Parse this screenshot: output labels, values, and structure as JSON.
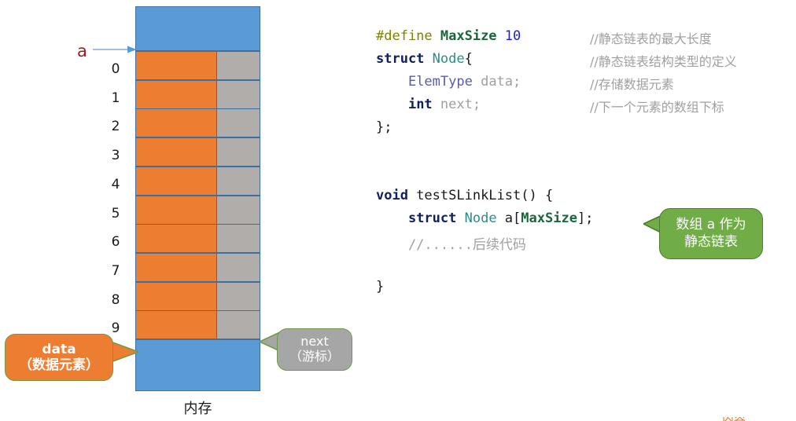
{
  "diagram": {
    "pointer_label": "a",
    "caption": "内存",
    "row_indices": [
      "0",
      "1",
      "2",
      "3",
      "4",
      "5",
      "6",
      "7",
      "8",
      "9"
    ],
    "row_count": 10,
    "callouts": {
      "data": {
        "title": "data",
        "subtitle": "（数据元素）"
      },
      "next": {
        "title": "next",
        "subtitle": "（游标）"
      }
    },
    "colors": {
      "memory_blue": "#5B9BD5",
      "data_orange": "#ED7D31",
      "next_gray": "#B0ADAB",
      "cell_border": "#3E6FA3",
      "pointer_red": "#9E1B1B",
      "arrow_blue": "#5B9BD5",
      "callout_green": "#70AD47",
      "callout_gray": "#A6A6A6"
    }
  },
  "code": {
    "lines": [
      {
        "tokens": [
          {
            "t": "#define ",
            "c": "tok-pre"
          },
          {
            "t": "MaxSize ",
            "c": "tok-macro"
          },
          {
            "t": "10",
            "c": "tok-num"
          }
        ],
        "comment": "//静态链表的最大长度"
      },
      {
        "tokens": [
          {
            "t": "struct ",
            "c": "tok-kw"
          },
          {
            "t": "Node",
            "c": "tok-type"
          },
          {
            "t": "{",
            "c": "tok-plain"
          }
        ],
        "comment": "//静态链表结构类型的定义"
      },
      {
        "tokens": [
          {
            "t": "    ",
            "c": "tok-plain"
          },
          {
            "t": "ElemType ",
            "c": "tok-cls"
          },
          {
            "t": "data;",
            "c": "tok-var"
          }
        ],
        "comment": "//存储数据元素"
      },
      {
        "tokens": [
          {
            "t": "    ",
            "c": "tok-plain"
          },
          {
            "t": "int ",
            "c": "tok-kw"
          },
          {
            "t": "next;",
            "c": "tok-var"
          }
        ],
        "comment": "//下一个元素的数组下标"
      },
      {
        "tokens": [
          {
            "t": "};",
            "c": "tok-plain"
          }
        ],
        "comment": ""
      },
      {
        "blank": true
      },
      {
        "blank": true
      },
      {
        "tokens": [
          {
            "t": "void ",
            "c": "tok-kw"
          },
          {
            "t": "testSLinkList() {",
            "c": "tok-plain"
          }
        ],
        "comment": ""
      },
      {
        "tokens": [
          {
            "t": "    ",
            "c": "tok-plain"
          },
          {
            "t": "struct ",
            "c": "tok-kw"
          },
          {
            "t": "Node ",
            "c": "tok-type"
          },
          {
            "t": "a[",
            "c": "tok-plain"
          },
          {
            "t": "MaxSize",
            "c": "tok-macro"
          },
          {
            "t": "];",
            "c": "tok-plain"
          }
        ],
        "comment": ""
      },
      {
        "tokens": [
          {
            "t": "    //......后续代码",
            "c": "tok-var"
          }
        ],
        "comment": ""
      },
      {
        "blank": true
      },
      {
        "tokens": [
          {
            "t": "}",
            "c": "tok-plain"
          }
        ],
        "comment": ""
      }
    ],
    "callout": {
      "line1": "数组 a 作为",
      "line2": "静态链表"
    }
  },
  "corner": {
    "mark": "内容"
  }
}
